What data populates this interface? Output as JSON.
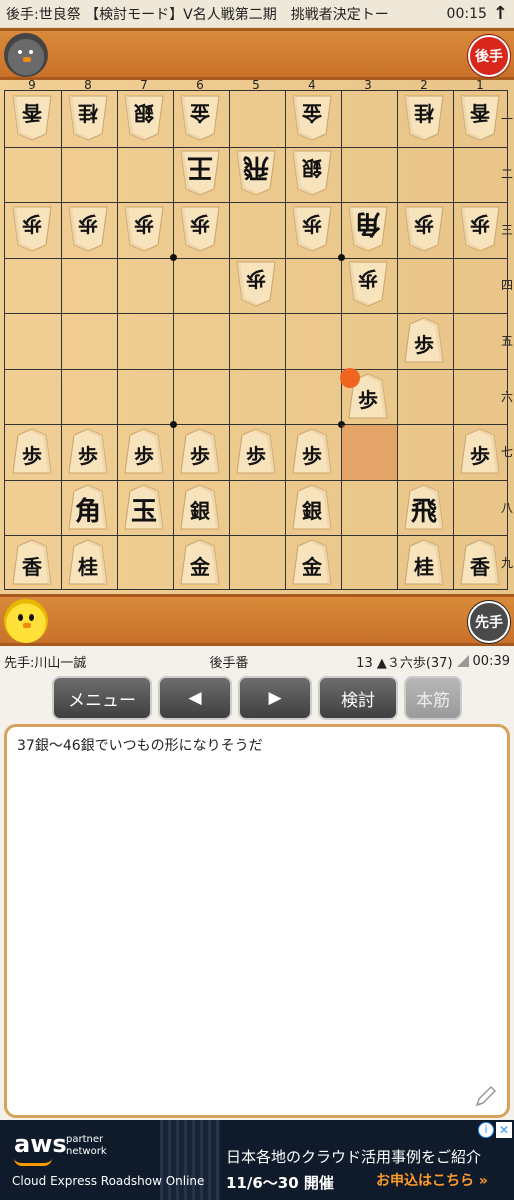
{
  "statusbar": {
    "title": "後手:世良祭 【検討モード】V名人戦第二期　挑戦者決定トー",
    "clock": "00:15",
    "arrow": "↑"
  },
  "gote": {
    "badge": "後手",
    "avatar": "gray-bird-icon"
  },
  "sente": {
    "badge": "先手",
    "avatar": "yellow-chick-icon"
  },
  "board": {
    "files": [
      "9",
      "8",
      "7",
      "6",
      "5",
      "4",
      "3",
      "2",
      "1"
    ],
    "ranks": [
      "一",
      "二",
      "三",
      "四",
      "五",
      "六",
      "七",
      "八",
      "九"
    ],
    "last_move_highlight": {
      "file": 3,
      "rank": 7
    },
    "last_move_marker": {
      "file": 3,
      "rank": 6
    },
    "pieces": [
      {
        "file": 9,
        "rank": 1,
        "owner": "gote",
        "kanji": "香"
      },
      {
        "file": 8,
        "rank": 1,
        "owner": "gote",
        "kanji": "桂"
      },
      {
        "file": 7,
        "rank": 1,
        "owner": "gote",
        "kanji": "銀"
      },
      {
        "file": 6,
        "rank": 1,
        "owner": "gote",
        "kanji": "金"
      },
      {
        "file": 4,
        "rank": 1,
        "owner": "gote",
        "kanji": "金"
      },
      {
        "file": 2,
        "rank": 1,
        "owner": "gote",
        "kanji": "桂"
      },
      {
        "file": 1,
        "rank": 1,
        "owner": "gote",
        "kanji": "香"
      },
      {
        "file": 6,
        "rank": 2,
        "owner": "gote",
        "kanji": "王"
      },
      {
        "file": 5,
        "rank": 2,
        "owner": "gote",
        "kanji": "飛"
      },
      {
        "file": 4,
        "rank": 2,
        "owner": "gote",
        "kanji": "銀"
      },
      {
        "file": 9,
        "rank": 3,
        "owner": "gote",
        "kanji": "歩"
      },
      {
        "file": 8,
        "rank": 3,
        "owner": "gote",
        "kanji": "歩"
      },
      {
        "file": 7,
        "rank": 3,
        "owner": "gote",
        "kanji": "歩"
      },
      {
        "file": 6,
        "rank": 3,
        "owner": "gote",
        "kanji": "歩"
      },
      {
        "file": 4,
        "rank": 3,
        "owner": "gote",
        "kanji": "歩"
      },
      {
        "file": 3,
        "rank": 3,
        "owner": "gote",
        "kanji": "角"
      },
      {
        "file": 2,
        "rank": 3,
        "owner": "gote",
        "kanji": "歩"
      },
      {
        "file": 1,
        "rank": 3,
        "owner": "gote",
        "kanji": "歩"
      },
      {
        "file": 5,
        "rank": 4,
        "owner": "gote",
        "kanji": "歩"
      },
      {
        "file": 3,
        "rank": 4,
        "owner": "gote",
        "kanji": "歩"
      },
      {
        "file": 2,
        "rank": 5,
        "owner": "sente",
        "kanji": "歩"
      },
      {
        "file": 3,
        "rank": 6,
        "owner": "sente",
        "kanji": "歩"
      },
      {
        "file": 9,
        "rank": 7,
        "owner": "sente",
        "kanji": "歩"
      },
      {
        "file": 8,
        "rank": 7,
        "owner": "sente",
        "kanji": "歩"
      },
      {
        "file": 7,
        "rank": 7,
        "owner": "sente",
        "kanji": "歩"
      },
      {
        "file": 6,
        "rank": 7,
        "owner": "sente",
        "kanji": "歩"
      },
      {
        "file": 5,
        "rank": 7,
        "owner": "sente",
        "kanji": "歩"
      },
      {
        "file": 4,
        "rank": 7,
        "owner": "sente",
        "kanji": "歩"
      },
      {
        "file": 1,
        "rank": 7,
        "owner": "sente",
        "kanji": "歩"
      },
      {
        "file": 8,
        "rank": 8,
        "owner": "sente",
        "kanji": "角"
      },
      {
        "file": 7,
        "rank": 8,
        "owner": "sente",
        "kanji": "玉"
      },
      {
        "file": 6,
        "rank": 8,
        "owner": "sente",
        "kanji": "銀"
      },
      {
        "file": 4,
        "rank": 8,
        "owner": "sente",
        "kanji": "銀"
      },
      {
        "file": 2,
        "rank": 8,
        "owner": "sente",
        "kanji": "飛"
      },
      {
        "file": 9,
        "rank": 9,
        "owner": "sente",
        "kanji": "香"
      },
      {
        "file": 8,
        "rank": 9,
        "owner": "sente",
        "kanji": "桂"
      },
      {
        "file": 6,
        "rank": 9,
        "owner": "sente",
        "kanji": "金"
      },
      {
        "file": 4,
        "rank": 9,
        "owner": "sente",
        "kanji": "金"
      },
      {
        "file": 2,
        "rank": 9,
        "owner": "sente",
        "kanji": "桂"
      },
      {
        "file": 1,
        "rank": 9,
        "owner": "sente",
        "kanji": "香"
      }
    ]
  },
  "info": {
    "sente_name": "先手:川山一誠",
    "turn": "後手番",
    "move": "13 ▲３六歩(37)",
    "clock": "00:39"
  },
  "toolbar": {
    "menu": "メニュー",
    "prev": "◀",
    "next": "▶",
    "analyze": "検討",
    "mainline": "本筋"
  },
  "comment": {
    "text": "37銀〜46銀でいつもの形になりそうだ"
  },
  "ad": {
    "logo": "aws",
    "partner_line1": "partner",
    "partner_line2": "network",
    "event": "Cloud Express Roadshow Online",
    "headline": "日本各地のクラウド活用事例をご紹介",
    "date": "11/6〜30 開催",
    "cta": "お申込はこちら »"
  }
}
